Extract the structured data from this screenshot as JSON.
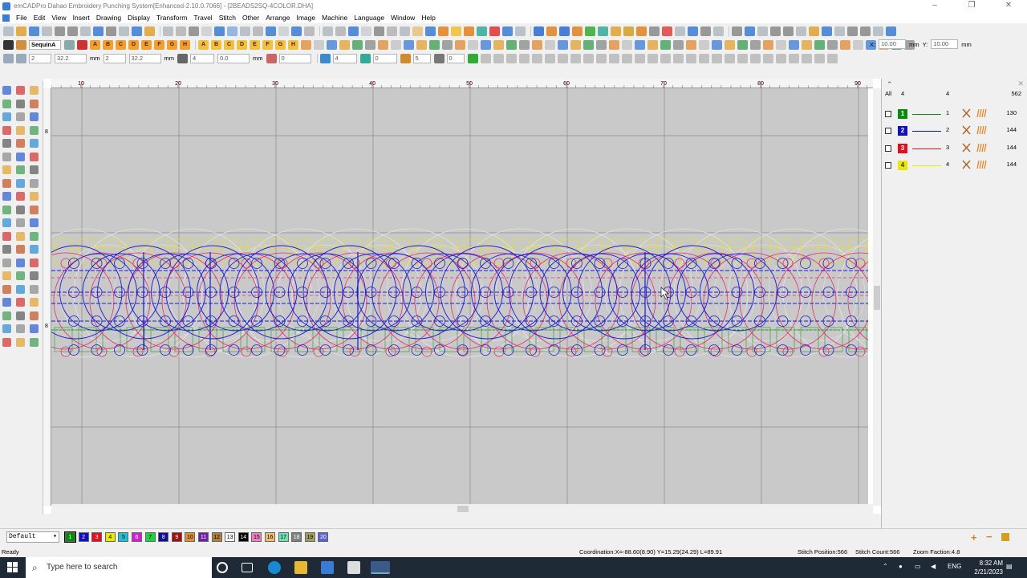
{
  "window": {
    "title": "emCADPro Dahao Embroidery Punching System[Enhanced-2.10.0.7066] - [2BEADS2SQ-4COLOR.DHA]",
    "controls": [
      "–",
      "❐",
      "✕"
    ]
  },
  "menu": [
    "File",
    "Edit",
    "View",
    "Insert",
    "Drawing",
    "Display",
    "Transform",
    "Travel",
    "Stitch",
    "Other",
    "Arrange",
    "Image",
    "Machine",
    "Language",
    "Window",
    "Help"
  ],
  "toolbar2": {
    "sequin_label": "SequinA",
    "letters": [
      "A",
      "B",
      "C",
      "D",
      "E",
      "F",
      "G",
      "H",
      "A",
      "B",
      "C",
      "D",
      "E",
      "F",
      "G",
      "H"
    ]
  },
  "toolbar3": {
    "v1": "2",
    "v2": "32.2",
    "unit1": "mm",
    "v3": "2",
    "v4": "32.2",
    "unit2": "mm",
    "v5": "4",
    "v6": "0.0",
    "unit3": "mm",
    "v7": "0",
    "v8": "4",
    "v9": "0",
    "v10": "5",
    "v11": "0"
  },
  "coord_fields": {
    "x_label": "X:",
    "x_val": "10.00",
    "x_unit": "mm",
    "y_label": "Y:",
    "y_val": "10.00",
    "y_unit": "mm"
  },
  "ruler_top": [
    "10",
    "20",
    "30",
    "40",
    "50",
    "60",
    "70",
    "80",
    "90"
  ],
  "ruler_left": [
    "8",
    "8",
    "8"
  ],
  "color_panel": {
    "header_all": "All",
    "header_count": "4",
    "header_idx": "4",
    "header_total": "562",
    "rows": [
      {
        "num": "1",
        "idx": "1",
        "count": "130",
        "color": "#0a8a0a"
      },
      {
        "num": "2",
        "idx": "2",
        "count": "144",
        "color": "#1010c0"
      },
      {
        "num": "3",
        "idx": "3",
        "count": "144",
        "color": "#e01020"
      },
      {
        "num": "4",
        "idx": "4",
        "count": "144",
        "color": "#e8e800"
      }
    ]
  },
  "colorbar": {
    "select_value": "Default",
    "chips": [
      {
        "n": "1",
        "c": "#0a8a0a"
      },
      {
        "n": "2",
        "c": "#1010c0"
      },
      {
        "n": "3",
        "c": "#e01020"
      },
      {
        "n": "4",
        "c": "#e8e800"
      },
      {
        "n": "5",
        "c": "#20c0d0"
      },
      {
        "n": "6",
        "c": "#d020d0"
      },
      {
        "n": "7",
        "c": "#20d040"
      },
      {
        "n": "8",
        "c": "#101090"
      },
      {
        "n": "9",
        "c": "#a01010"
      },
      {
        "n": "10",
        "c": "#e09030"
      },
      {
        "n": "11",
        "c": "#7020a0"
      },
      {
        "n": "12",
        "c": "#b08040"
      },
      {
        "n": "13",
        "c": "#ffffff"
      },
      {
        "n": "14",
        "c": "#000000"
      },
      {
        "n": "15",
        "c": "#f080c0"
      },
      {
        "n": "16",
        "c": "#f0c070"
      },
      {
        "n": "17",
        "c": "#70e0b0"
      },
      {
        "n": "18",
        "c": "#808080"
      },
      {
        "n": "19",
        "c": "#a0a060"
      },
      {
        "n": "20",
        "c": "#6060d0"
      }
    ]
  },
  "status": {
    "ready": "Ready",
    "coordination": "Coordination:X=-88.60(8.90) Y=15.29(24.29) L=89.91",
    "stitch_position": "Stitch Position:566",
    "stitch_count": "Stitch Count:566",
    "zoom": "Zoom Faction:4.8"
  },
  "taskbar": {
    "search_placeholder": "Type here to search",
    "lang": "ENG",
    "time": "8:32 AM",
    "date": "2/21/2023"
  },
  "design": {
    "blue": "#1a1ad0",
    "red": "#e0306a",
    "yellow": "#e8e800",
    "green": "#20a020",
    "ghost": "#e4e4e4"
  }
}
